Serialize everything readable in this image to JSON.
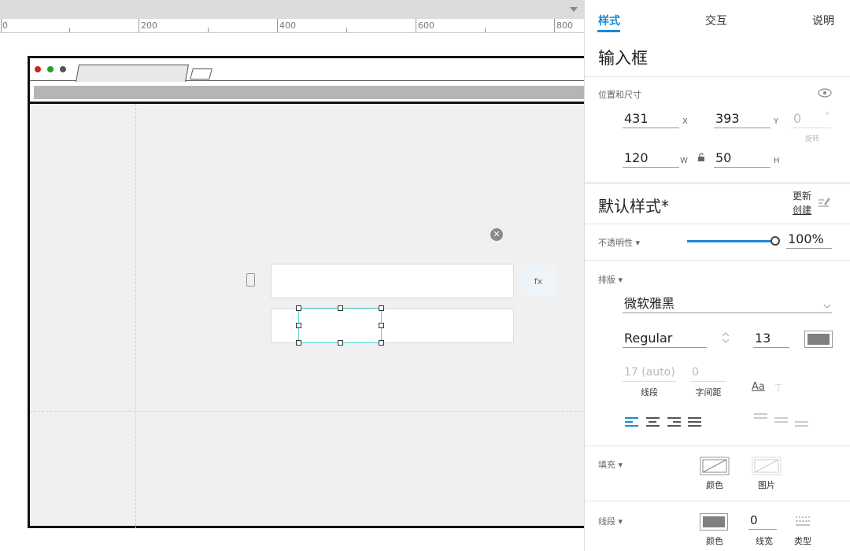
{
  "ruler": {
    "labels": [
      "0",
      "200",
      "400",
      "600",
      "800"
    ]
  },
  "canvas": {
    "fx_label": "fx",
    "close_glyph": "✕"
  },
  "panel": {
    "tabs": [
      "样式",
      "交互",
      "说明"
    ],
    "active_tab": "样式",
    "component_title": "输入框",
    "position_section": {
      "label": "位置和尺寸",
      "x": "431",
      "x_unit": "X",
      "y": "393",
      "y_unit": "Y",
      "rotation": "0",
      "rotation_unit": "°",
      "rotation_label": "旋转",
      "w": "120",
      "w_unit": "W",
      "h": "50",
      "h_unit": "H"
    },
    "style_section": {
      "title": "默认样式*",
      "update_link": "更新",
      "create_link": "创建"
    },
    "opacity": {
      "label": "不透明性 ▾",
      "value": "100%",
      "level": 1.0
    },
    "typography": {
      "label": "排版 ▾",
      "font_family": "微软雅黑",
      "font_weight": "Regular",
      "font_size": "13",
      "font_color": "#808080",
      "line_height": "17 (auto)",
      "line_height_label": "线段",
      "char_spacing": "0",
      "char_spacing_label": "字间距",
      "aa_label": "Aa"
    },
    "fill": {
      "label": "填充 ▾",
      "color_label": "颜色",
      "image_label": "图片"
    },
    "border": {
      "label": "线段 ▾",
      "color_label": "颜色",
      "width": "0",
      "width_label": "线宽",
      "type_label": "类型",
      "color": "#808080"
    },
    "accent_color": "#1a8ad4"
  }
}
